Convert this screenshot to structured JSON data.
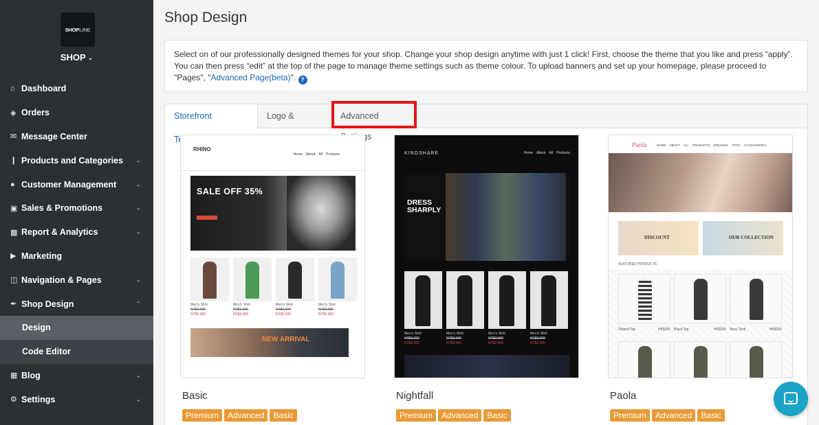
{
  "sidebar": {
    "logo_main": "SHOP",
    "logo_accent": "LINE",
    "shop_label": "SHOP",
    "items": [
      {
        "label": "Dashboard",
        "icon": "home-icon"
      },
      {
        "label": "Orders",
        "icon": "tag-icon"
      },
      {
        "label": "Message Center",
        "icon": "envelope-icon"
      },
      {
        "label": "Products and Categories",
        "icon": "barcode-icon"
      },
      {
        "label": "Customer Management",
        "icon": "users-icon"
      },
      {
        "label": "Sales & Promotions",
        "icon": "money-icon"
      },
      {
        "label": "Report & Analytics",
        "icon": "bar-chart-icon"
      },
      {
        "label": "Marketing",
        "icon": "bullhorn-icon"
      },
      {
        "label": "Navigation & Pages",
        "icon": "sitemap-icon"
      },
      {
        "label": "Shop Design",
        "icon": "paint-brush-icon"
      },
      {
        "label": "Design"
      },
      {
        "label": "Code Editor"
      },
      {
        "label": "Blog",
        "icon": "book-icon"
      },
      {
        "label": "Settings",
        "icon": "cog-icon"
      }
    ]
  },
  "main": {
    "title": "Shop Design",
    "info_text": "Select on of our professionally designed themes for your shop. Change your shop design anytime with just 1 click! First, choose the theme that you like and press “apply”. You can then press “edit” at the top of the page to manage theme settings such as theme colour. To upload banners and set up your homepage, please proceed to \"Pages\", \"",
    "info_link": "Advanced Page(beta)",
    "info_end": "\".",
    "tabs": [
      "Storefront Template",
      "Logo & Favicon",
      "Advanced Settings"
    ],
    "themes": [
      {
        "name": "Basic",
        "tags": [
          "Premium",
          "Advanced",
          "Basic"
        ],
        "thumb": {
          "logo": "RHINO",
          "menu": "Home About All Products",
          "hero": "SALE OFF 35%",
          "banner": "NEW ARRIVAL",
          "products": [
            {
              "name": "Men's Shirt",
              "old": "NT$2,000",
              "price": "NT$2,000"
            },
            {
              "name": "Men's Shirt",
              "old": "NT$2,000",
              "price": "NT$2,000"
            },
            {
              "name": "Men's Shirt",
              "old": "NT$2,000",
              "price": "NT$2,000"
            },
            {
              "name": "Men's Shirt",
              "old": "NT$2,000",
              "price": "NT$2,000"
            }
          ]
        }
      },
      {
        "name": "Nightfall",
        "tags": [
          "Premium",
          "Advanced",
          "Basic"
        ],
        "thumb": {
          "logo": "KINGSHARE",
          "menu": "Home About All Products",
          "hero_line1": "DRESS",
          "hero_line2": "SHARPLY",
          "products": [
            {
              "name": "Men's Shirt",
              "old": "NT$2,000",
              "price": "NT$2,000"
            },
            {
              "name": "Men's Shirt",
              "old": "NT$2,000",
              "price": "NT$2,000"
            },
            {
              "name": "Men's Shirt",
              "old": "NT$2,000",
              "price": "NT$2,000"
            },
            {
              "name": "Men's Shirt",
              "old": "NT$2,000",
              "price": "NT$2,000"
            }
          ]
        }
      },
      {
        "name": "Paola",
        "tags": [
          "Premium",
          "Advanced",
          "Basic"
        ],
        "thumb": {
          "logo": "Paola",
          "menu": "HOME ABOUT ALL PRODUCTS DRESSES TOPS ACCESSORIES",
          "banner1": "DISCOUNT",
          "banner2": "OUR COLLECTION",
          "featured": "FEATURED PRODUCTS",
          "products": [
            {
              "name": "Striped Top",
              "price": "HK$300"
            },
            {
              "name": "Black Top",
              "price": "HK$200"
            },
            {
              "name": "Navy Tank",
              "price": "HK$250"
            }
          ]
        }
      }
    ]
  },
  "colors": {
    "sidebar_bg": "#2b3035",
    "link": "#1a66b3",
    "tag": "#e89a35",
    "highlight": "#e3151a",
    "chat": "#1aa3c4"
  }
}
